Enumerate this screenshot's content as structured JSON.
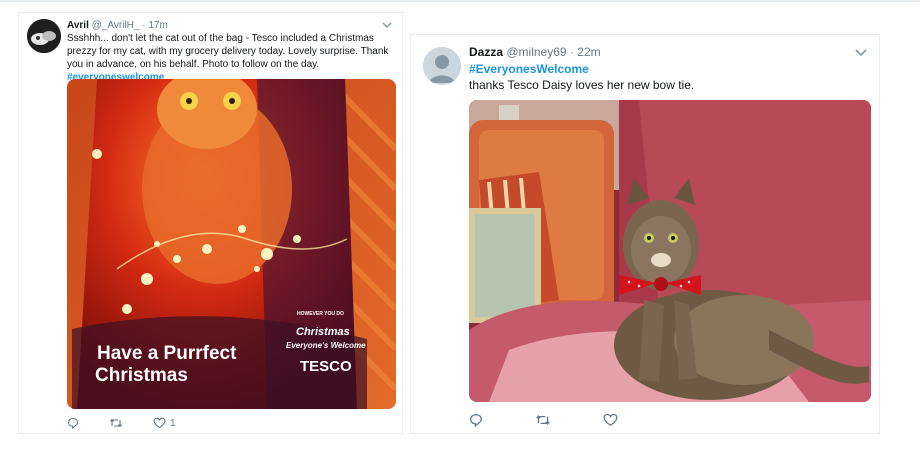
{
  "tweets": [
    {
      "display_name": "Avril",
      "handle": "@_AvrilH_",
      "separator": "·",
      "time": "17m",
      "text": "Ssshhh... don't let the cat out of the bag - Tesco included a Christmas prezzy for my cat, with my grocery delivery today. Lovely surprise. Thank you in advance, on his behalf. Photo to follow on the day.",
      "hashtag": "#everyoneswelcome",
      "image": {
        "headline_line1": "Have a Purrfect",
        "headline_line2": "Christmas",
        "badge_arc_text": "HOWEVER YOU DO",
        "badge_line1": "Christmas",
        "badge_line2": "Everyone's Welcome",
        "brand": "TESCO"
      },
      "actions": {
        "reply_count": "",
        "retweet_count": "",
        "like_count": "1"
      }
    },
    {
      "display_name": "Dazza",
      "handle": "@milney69",
      "separator": "·",
      "time": "22m",
      "hashtag": "#EveryonesWelcome",
      "text": "thanks Tesco Daisy loves her new bow tie.",
      "actions": {
        "reply_count": "",
        "retweet_count": "",
        "like_count": ""
      }
    }
  ],
  "icons": {
    "reply": "reply-icon",
    "retweet": "retweet-icon",
    "like": "heart-icon",
    "menu": "chevron-down-icon"
  },
  "colors": {
    "hashtag": "#1b95e0",
    "meta_text": "#657786",
    "border": "#e6ecf0",
    "poster_red": "#c8190f"
  }
}
